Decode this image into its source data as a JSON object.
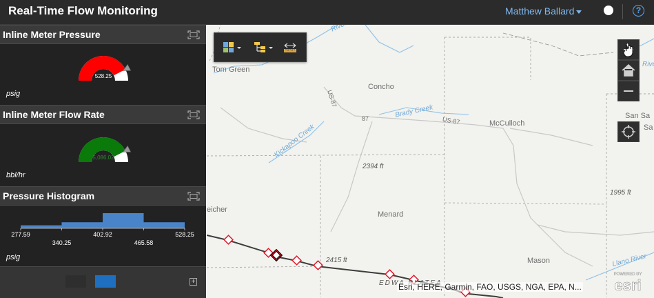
{
  "header": {
    "title": "Real-Time Flow Monitoring",
    "user_name": "Matthew Ballard",
    "help_label": "?"
  },
  "panels": {
    "pressure": {
      "title": "Inline Meter Pressure",
      "value": "528.25",
      "fraction": 0.85,
      "unit": "psig",
      "color": "#ff0000"
    },
    "flow": {
      "title": "Inline Meter Flow Rate",
      "value": "5,086.02",
      "fraction": 0.85,
      "unit": "bbl/hr",
      "color": "#0a7a0a"
    },
    "histogram": {
      "title": "Pressure Histogram",
      "unit": "psig",
      "ticks_top": [
        "277.59",
        "402.92",
        "528.25"
      ],
      "ticks_bottom": [
        "340.25",
        "465.58"
      ],
      "bins": [
        1,
        2,
        5,
        2
      ],
      "bar_color": "#4a84c8"
    }
  },
  "footer": {
    "swatch_dark": "#2e2e2e",
    "swatch_blue": "#1f6fc1",
    "add_label": "+"
  },
  "map": {
    "labels": {
      "tom_green": "Tom Green",
      "concho": "Concho",
      "mcculloch": "McCulloch",
      "menard": "Menard",
      "mason": "Mason",
      "schleicher": "eicher",
      "san_saba": "San Sa",
      "san_saba2": "Sa",
      "us87_a": "US-87",
      "us87_b": "87",
      "us87_c": "US-87",
      "elev_2394": "2394 ft",
      "elev_2415": "2415 ft",
      "elev_1995": "1995 ft",
      "edwards": "EDWA         PLATEA",
      "brady_creek": "Brady Creek",
      "kickapoo_creek": "Kickapoo Creek",
      "river_top": "River",
      "river_right": "Rive",
      "llano_river": "Llano River"
    },
    "attribution": "Esri, HERE, Garmin, FAO, USGS, NGA, EPA, N...",
    "esri_powered": "POWERED BY",
    "esri_brand": "esri"
  }
}
